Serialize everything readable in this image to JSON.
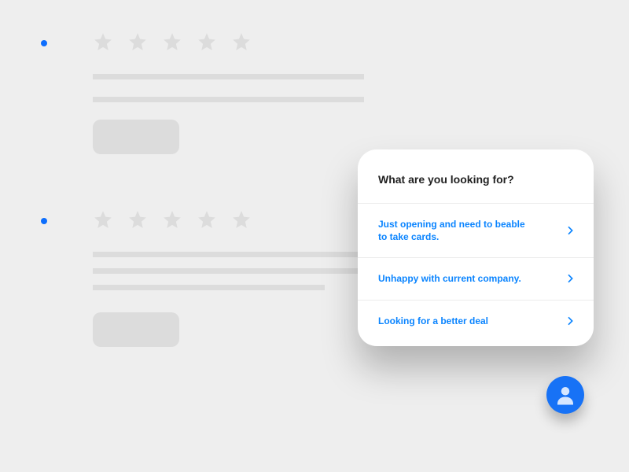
{
  "popup": {
    "title": "What are you looking for?",
    "options": [
      "Just opening and need to beable to take  cards.",
      "Unhappy with current company.",
      "Looking for a better deal"
    ]
  },
  "colors": {
    "accent": "#0a84ff",
    "bullet": "#0d6efd",
    "avatar_bg": "#1772f6"
  }
}
